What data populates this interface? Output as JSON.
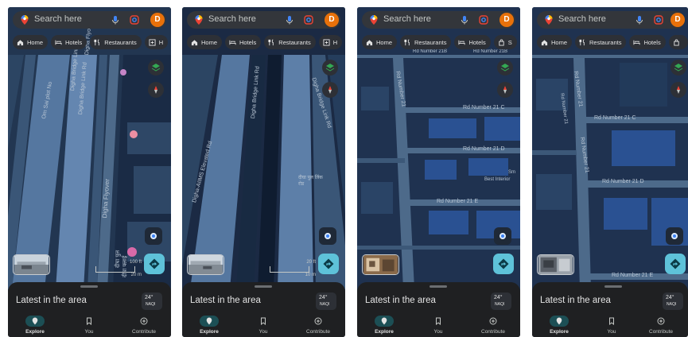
{
  "search": {
    "placeholder": "Search here"
  },
  "user": {
    "initial": "D"
  },
  "sheet": {
    "title": "Latest in the area",
    "weather": {
      "temp": "24°",
      "aqi_label": "NAQI"
    }
  },
  "nav": {
    "explore": "Explore",
    "you": "You",
    "contribute": "Contribute"
  },
  "chips": {
    "home": "Home",
    "hotels": "Hotels",
    "restaurants": "Restaurants",
    "partial_h": "H",
    "partial_s": "S"
  },
  "colors": {
    "accent": "#5ec2d9",
    "avatar": "#e8710a",
    "map_bg": "#223651",
    "road": "#4d6a8a"
  },
  "screens": [
    {
      "scale": {
        "top": "100 ft",
        "bottom": "20 m"
      },
      "labels": {
        "road_1": "Digha Bridge Link Rd",
        "road_2": "Digha Flyover",
        "road_3": "Digha Bridge Link Rd",
        "road_4": "Digha Flyover",
        "road_5": "Om Sai plot No",
        "road_6": "दीघा पुल",
        "road_7": "दीघा फ्लाई"
      }
    },
    {
      "scale": {
        "top": "20 ft",
        "bottom": "10 m"
      },
      "labels": {
        "road_1": "Digha-AIIMS Elevated Rd",
        "road_2": "Digha Bridge Link Rd",
        "road_3": "Digha Bridge Link Rd",
        "road_4": "दीघा पुल लिंक रोड"
      }
    },
    {
      "labels": {
        "road_1": "Rd Number 21",
        "road_2": "Rd Number 21 C",
        "road_3": "Rd Number 21 D",
        "road_4": "Rd Number 21 E",
        "road_5": "Rd Number 21B",
        "road_6": "Rd Number 21B",
        "poi": "Best Interior",
        "poi_sm": "Sm"
      }
    },
    {
      "labels": {
        "road_1": "Rd Number 21",
        "road_2": "Rd Number 21 C",
        "road_3": "Rd Number 21 D",
        "road_4": "Rd Number 21 E",
        "road_5": "Rd Number 21",
        "road_6": "Rd Number 21"
      }
    }
  ]
}
